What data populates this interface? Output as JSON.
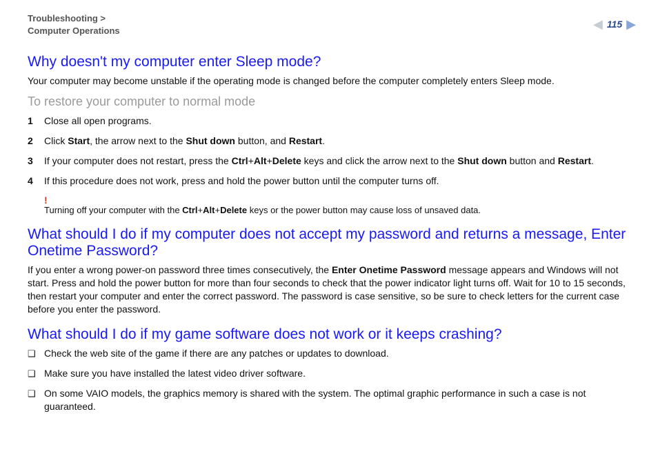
{
  "breadcrumb": {
    "line1": "Troubleshooting >",
    "line2": "Computer Operations"
  },
  "page_number": "115",
  "section1": {
    "heading": "Why doesn't my computer enter Sleep mode?",
    "intro": "Your computer may become unstable if the operating mode is changed before the computer completely enters Sleep mode.",
    "subheading": "To restore your computer to normal mode",
    "step1": {
      "num": "1",
      "text": "Close all open programs."
    },
    "step2": {
      "num": "2",
      "t1": "Click ",
      "b1": "Start",
      "t2": ", the arrow next to the ",
      "b2": "Shut down",
      "t3": " button, and ",
      "b3": "Restart",
      "t4": "."
    },
    "step3": {
      "num": "3",
      "t1": "If your computer does not restart, press the ",
      "b1": "Ctrl",
      "t2": "+",
      "b2": "Alt",
      "t3": "+",
      "b3": "Delete",
      "t4": " keys and click the arrow next to the ",
      "b4": "Shut down",
      "t5": " button and ",
      "b5": "Restart",
      "t6": "."
    },
    "step4": {
      "num": "4",
      "text": "If this procedure does not work, press and hold the power button until the computer turns off."
    },
    "warning": {
      "bang": "!",
      "t1": "Turning off your computer with the ",
      "b1": "Ctrl",
      "t2": "+",
      "b2": "Alt",
      "t3": "+",
      "b3": "Delete",
      "t4": " keys or the power button may cause loss of unsaved data."
    }
  },
  "section2": {
    "heading": "What should I do if my computer does not accept my password and returns a message, Enter Onetime Password?",
    "p_t1": "If you enter a wrong power-on password three times consecutively, the ",
    "p_b1": "Enter Onetime Password",
    "p_t2": " message appears and Windows will not start. Press and hold the power button for more than four seconds to check that the power indicator light turns off. Wait for 10 to 15 seconds, then restart your computer and enter the correct password. The password is case sensitive, so be sure to check letters for the current case before you enter the password."
  },
  "section3": {
    "heading": "What should I do if my game software does not work or it keeps crashing?",
    "item1": "Check the web site of the game if there are any patches or updates to download.",
    "item2": "Make sure you have installed the latest video driver software.",
    "item3": "On some VAIO models, the graphics memory is shared with the system. The optimal graphic performance in such a case is not guaranteed."
  }
}
